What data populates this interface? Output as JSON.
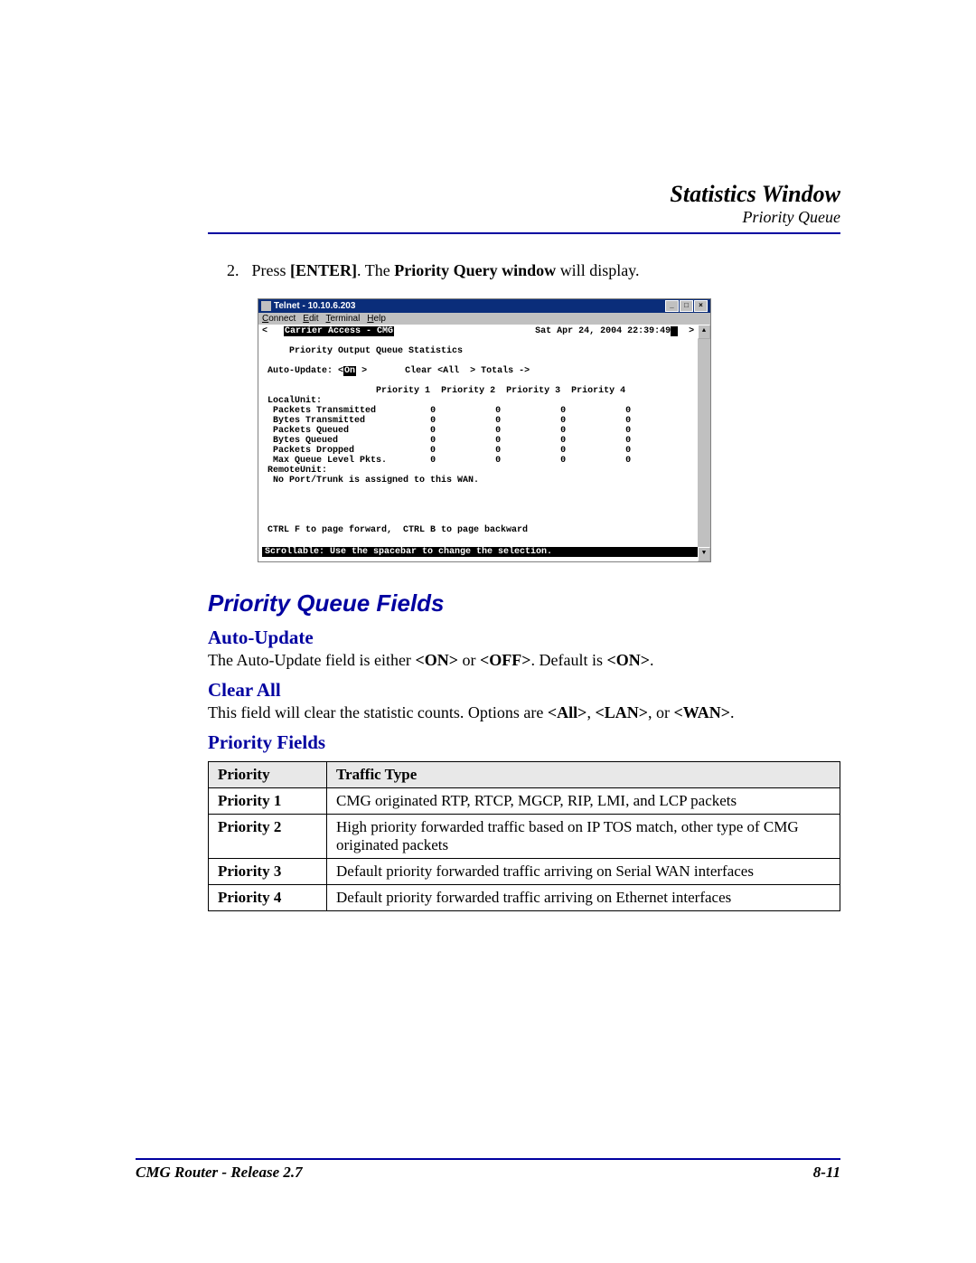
{
  "header": {
    "title": "Statistics Window",
    "subtitle": "Priority Queue"
  },
  "instruction": {
    "number": "2.",
    "pre": "Press ",
    "key": "[ENTER]",
    "mid": ". The ",
    "boldwin": "Priority Query window",
    "post": " will display."
  },
  "telnet": {
    "title": "Telnet - 10.10.6.203",
    "menu": {
      "connect": "Connect",
      "edit": "Edit",
      "terminal": "Terminal",
      "help": "Help"
    },
    "banner_left": "Carrier Access - CMG",
    "banner_right": "Sat Apr 24, 2004 22:39:49",
    "heading": "Priority Output Queue Statistics",
    "auto_update_label": "Auto-Update:",
    "auto_update_value": "On",
    "clear_label": "Clear <All  > Totals ->",
    "col1": "Priority 1",
    "col2": "Priority 2",
    "col3": "Priority 3",
    "col4": "Priority 4",
    "localunit": "LocalUnit:",
    "rows": [
      {
        "label": "Packets Transmitted",
        "v": [
          "0",
          "0",
          "0",
          "0"
        ]
      },
      {
        "label": "Bytes Transmitted",
        "v": [
          "0",
          "0",
          "0",
          "0"
        ]
      },
      {
        "label": "Packets Queued",
        "v": [
          "0",
          "0",
          "0",
          "0"
        ]
      },
      {
        "label": "Bytes Queued",
        "v": [
          "0",
          "0",
          "0",
          "0"
        ]
      },
      {
        "label": "Packets Dropped",
        "v": [
          "0",
          "0",
          "0",
          "0"
        ]
      },
      {
        "label": "Max Queue Level Pkts.",
        "v": [
          "0",
          "0",
          "0",
          "0"
        ]
      }
    ],
    "remoteunit": "RemoteUnit:",
    "remote_msg": "No Port/Trunk is assigned to this WAN.",
    "paging": "CTRL F to page forward,  CTRL B to page backward",
    "status": "Scrollable: Use the spacebar to change the selection."
  },
  "section": {
    "title": "Priority Queue Fields",
    "auto_update": {
      "title": "Auto-Update",
      "body_pre": "The Auto-Update field is either ",
      "on": "<ON>",
      "mid": " or ",
      "off": "<OFF>",
      "post": ". Default is ",
      "def": "<ON>",
      "end": "."
    },
    "clear_all": {
      "title": "Clear All",
      "body_pre": "This field will clear the statistic counts. Options are ",
      "o1": "<All>",
      "c1": ", ",
      "o2": "<LAN>",
      "c2": ", or ",
      "o3": "<WAN>",
      "end": "."
    },
    "priority_fields": {
      "title": "Priority Fields"
    }
  },
  "table": {
    "headers": [
      "Priority",
      "Traffic Type"
    ],
    "rows": [
      {
        "p": "Priority 1",
        "t": "CMG originated RTP, RTCP, MGCP, RIP, LMI, and LCP packets"
      },
      {
        "p": "Priority 2",
        "t": "High priority forwarded traffic based on IP TOS match, other type of CMG originated packets"
      },
      {
        "p": "Priority 3",
        "t": "Default priority forwarded traffic arriving on Serial WAN interfaces"
      },
      {
        "p": "Priority 4",
        "t": "Default priority forwarded traffic arriving on Ethernet interfaces"
      }
    ]
  },
  "footer": {
    "left": "CMG Router - Release 2.7",
    "right": "8-11"
  }
}
